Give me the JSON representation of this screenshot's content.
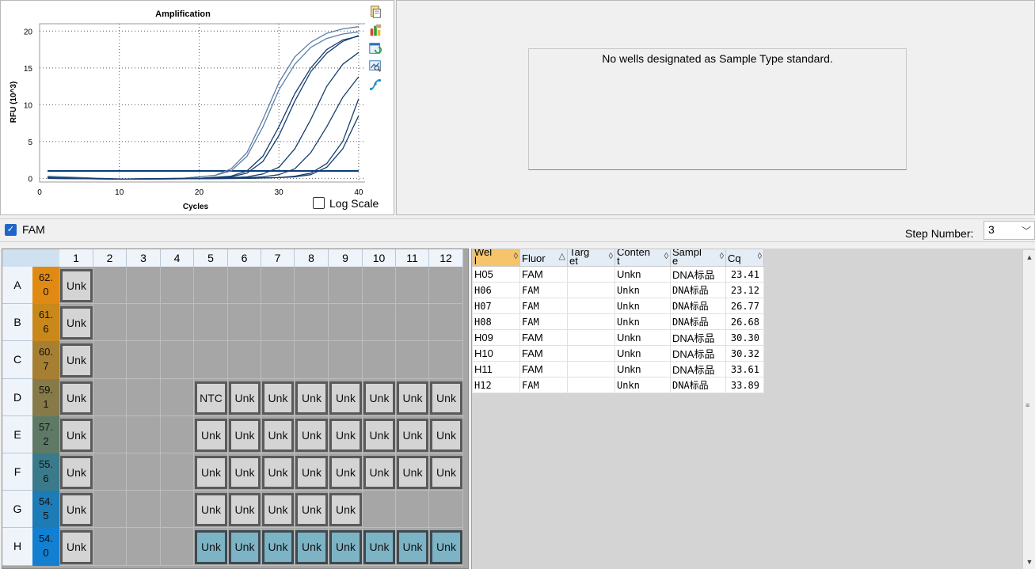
{
  "chart_data": {
    "type": "line",
    "title": "Amplification",
    "xlabel": "Cycles",
    "ylabel": "RFU (10^3)",
    "xlim": [
      0,
      41
    ],
    "ylim": [
      -0.5,
      21
    ],
    "x_ticks": [
      "0",
      "10",
      "20",
      "30",
      "40"
    ],
    "y_ticks": [
      "0",
      "5",
      "10",
      "15",
      "20"
    ],
    "grid": true,
    "threshold": 1.0,
    "series": [
      {
        "values": [
          [
            1,
            0.3
          ],
          [
            10,
            -0.1
          ],
          [
            18,
            0.0
          ],
          [
            22,
            0.4
          ],
          [
            24,
            1.3
          ],
          [
            26,
            3.5
          ],
          [
            28,
            8.0
          ],
          [
            30,
            13.0
          ],
          [
            32,
            16.5
          ],
          [
            34,
            18.5
          ],
          [
            36,
            19.7
          ],
          [
            38,
            20.3
          ],
          [
            40,
            20.6
          ]
        ]
      },
      {
        "values": [
          [
            1,
            0.2
          ],
          [
            10,
            -0.1
          ],
          [
            18,
            0.0
          ],
          [
            22,
            0.4
          ],
          [
            24,
            1.0
          ],
          [
            26,
            3.0
          ],
          [
            28,
            7.0
          ],
          [
            30,
            12.0
          ],
          [
            32,
            15.5
          ],
          [
            34,
            17.8
          ],
          [
            36,
            19.0
          ],
          [
            38,
            19.6
          ],
          [
            40,
            19.9
          ]
        ]
      },
      {
        "values": [
          [
            1,
            0.1
          ],
          [
            10,
            -0.1
          ],
          [
            20,
            0.0
          ],
          [
            24,
            0.3
          ],
          [
            26,
            1.0
          ],
          [
            28,
            3.0
          ],
          [
            30,
            7.0
          ],
          [
            32,
            11.5
          ],
          [
            34,
            15.0
          ],
          [
            36,
            17.5
          ],
          [
            38,
            18.8
          ],
          [
            40,
            19.3
          ]
        ]
      },
      {
        "values": [
          [
            1,
            0.1
          ],
          [
            10,
            -0.1
          ],
          [
            20,
            0.0
          ],
          [
            24,
            0.2
          ],
          [
            26,
            0.7
          ],
          [
            28,
            2.3
          ],
          [
            30,
            5.8
          ],
          [
            32,
            10.5
          ],
          [
            34,
            14.5
          ],
          [
            36,
            17.0
          ],
          [
            38,
            18.6
          ],
          [
            40,
            19.4
          ]
        ]
      },
      {
        "values": [
          [
            1,
            0.1
          ],
          [
            10,
            -0.1
          ],
          [
            22,
            0.0
          ],
          [
            26,
            0.2
          ],
          [
            28,
            0.6
          ],
          [
            30,
            1.5
          ],
          [
            32,
            4.0
          ],
          [
            34,
            8.0
          ],
          [
            36,
            12.5
          ],
          [
            38,
            15.5
          ],
          [
            40,
            17.1
          ]
        ]
      },
      {
        "values": [
          [
            1,
            0.0
          ],
          [
            10,
            -0.1
          ],
          [
            24,
            0.0
          ],
          [
            28,
            0.2
          ],
          [
            30,
            0.5
          ],
          [
            32,
            1.3
          ],
          [
            34,
            3.5
          ],
          [
            36,
            7.0
          ],
          [
            38,
            11.0
          ],
          [
            40,
            13.8
          ]
        ]
      },
      {
        "values": [
          [
            1,
            0.0
          ],
          [
            12,
            -0.1
          ],
          [
            26,
            0.0
          ],
          [
            30,
            0.1
          ],
          [
            32,
            0.3
          ],
          [
            34,
            0.7
          ],
          [
            36,
            2.0
          ],
          [
            38,
            5.0
          ],
          [
            40,
            10.8
          ]
        ]
      },
      {
        "values": [
          [
            1,
            0.0
          ],
          [
            12,
            -0.1
          ],
          [
            26,
            0.0
          ],
          [
            30,
            0.1
          ],
          [
            32,
            0.2
          ],
          [
            34,
            0.5
          ],
          [
            36,
            1.5
          ],
          [
            38,
            4.0
          ],
          [
            40,
            8.5
          ]
        ]
      }
    ]
  },
  "chart_panel": {
    "log_scale_label": "Log Scale"
  },
  "toolbar_icons": [
    "copy-icon",
    "export-icon",
    "refresh-icon",
    "zoom-icon",
    "curve-icon"
  ],
  "std_panel": {
    "message": "No wells designated as Sample Type standard."
  },
  "filter_bar": {
    "fam_label": "FAM",
    "step_label": "Step Number:",
    "step_value": "3"
  },
  "plate": {
    "columns": [
      "1",
      "2",
      "3",
      "4",
      "5",
      "6",
      "7",
      "8",
      "9",
      "10",
      "11",
      "12"
    ],
    "rows": [
      {
        "label": "A",
        "temp": "62.\n0",
        "color": "#e08a14",
        "wells": [
          "Unk",
          null,
          null,
          null,
          null,
          null,
          null,
          null,
          null,
          null,
          null,
          null
        ]
      },
      {
        "label": "B",
        "temp": "61.\n6",
        "color": "#c8881a",
        "wells": [
          "Unk",
          null,
          null,
          null,
          null,
          null,
          null,
          null,
          null,
          null,
          null,
          null
        ]
      },
      {
        "label": "C",
        "temp": "60.\n7",
        "color": "#a67f32",
        "wells": [
          "Unk",
          null,
          null,
          null,
          null,
          null,
          null,
          null,
          null,
          null,
          null,
          null
        ]
      },
      {
        "label": "D",
        "temp": "59.\n1",
        "color": "#867a48",
        "wells": [
          "Unk",
          null,
          null,
          null,
          "NTC",
          "Unk",
          "Unk",
          "Unk",
          "Unk",
          "Unk",
          "Unk",
          "Unk"
        ]
      },
      {
        "label": "E",
        "temp": "57.\n2",
        "color": "#5e7a66",
        "wells": [
          "Unk",
          null,
          null,
          null,
          "Unk",
          "Unk",
          "Unk",
          "Unk",
          "Unk",
          "Unk",
          "Unk",
          "Unk"
        ]
      },
      {
        "label": "F",
        "temp": "55.\n6",
        "color": "#3b7a8a",
        "wells": [
          "Unk",
          null,
          null,
          null,
          "Unk",
          "Unk",
          "Unk",
          "Unk",
          "Unk",
          "Unk",
          "Unk",
          "Unk"
        ]
      },
      {
        "label": "G",
        "temp": "54.\n5",
        "color": "#1d7bb5",
        "wells": [
          "Unk",
          null,
          null,
          null,
          "Unk",
          "Unk",
          "Unk",
          "Unk",
          "Unk",
          null,
          null,
          null
        ]
      },
      {
        "label": "H",
        "temp": "54.\n0",
        "color": "#127fd0",
        "wells": [
          "Unk",
          null,
          null,
          null,
          "Unk",
          "Unk",
          "Unk",
          "Unk",
          "Unk",
          "Unk",
          "Unk",
          "Unk"
        ],
        "selected_from": 4
      }
    ]
  },
  "results_table": {
    "headers": [
      "Wel\nl",
      "Fluor",
      "Targ\net",
      "Conten\nt",
      "Sampl\ne",
      "Cq"
    ],
    "rows": [
      [
        "H05",
        "FAM",
        "",
        "Unkn",
        "DNA标品",
        "23.41"
      ],
      [
        "H06",
        "FAM",
        "",
        "Unkn",
        "DNA标品",
        "23.12"
      ],
      [
        "H07",
        "FAM",
        "",
        "Unkn",
        "DNA标品",
        "26.77"
      ],
      [
        "H08",
        "FAM",
        "",
        "Unkn",
        "DNA标品",
        "26.68"
      ],
      [
        "H09",
        "FAM",
        "",
        "Unkn",
        "DNA标品",
        "30.30"
      ],
      [
        "H10",
        "FAM",
        "",
        "Unkn",
        "DNA标品",
        "30.32"
      ],
      [
        "H11",
        "FAM",
        "",
        "Unkn",
        "DNA标品",
        "33.61"
      ],
      [
        "H12",
        "FAM",
        "",
        "Unkn",
        "DNA标品",
        "33.89"
      ]
    ]
  }
}
